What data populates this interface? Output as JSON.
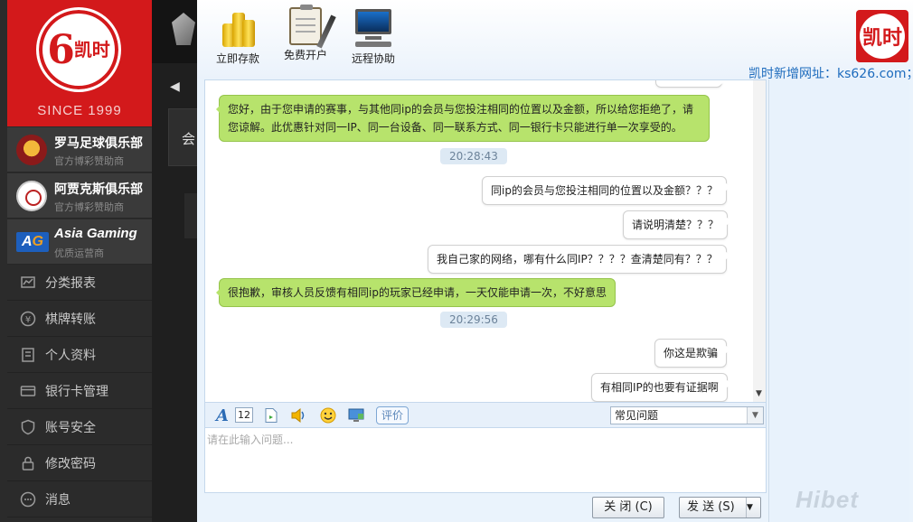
{
  "site": {
    "logo_text": "凯时",
    "since": "SINCE 1999",
    "sponsors": [
      {
        "name": "罗马足球俱乐部",
        "sub": "官方博彩赞助商"
      },
      {
        "name": "阿贾克斯俱乐部",
        "sub": "官方博彩赞助商"
      },
      {
        "name": "Asia Gaming",
        "sub": "优质运营商"
      }
    ],
    "menu": [
      {
        "label": "分类报表",
        "icon": "report-icon"
      },
      {
        "label": "棋牌转账",
        "icon": "yen-transfer-icon"
      },
      {
        "label": "个人资料",
        "icon": "profile-icon"
      },
      {
        "label": "银行卡管理",
        "icon": "bank-card-icon"
      },
      {
        "label": "账号安全",
        "icon": "shield-icon"
      },
      {
        "label": "修改密码",
        "icon": "lock-icon"
      },
      {
        "label": "消息",
        "icon": "message-icon"
      }
    ],
    "bg_panel_char": "会"
  },
  "chat": {
    "toolbar": [
      {
        "label": "立即存款",
        "icon": "coins-icon"
      },
      {
        "label": "免费开户",
        "icon": "notepad-icon"
      },
      {
        "label": "远程协助",
        "icon": "monitor-icon"
      }
    ],
    "brand_logo": "凯时",
    "site_url": "凯时新增网址：ks626.com；",
    "messages": [
      {
        "type": "agent",
        "text": "您好，由于您申请的赛事，与其他同ip的会员与您投注相同的位置以及金额，所以给您拒绝了，请您谅解。此优惠针对同一IP、同一台设备、同一联系方式、同一银行卡只能进行单一次享受的。"
      },
      {
        "type": "time",
        "text": "20:28:43"
      },
      {
        "type": "user",
        "text": "同ip的会员与您投注相同的位置以及金额？？？"
      },
      {
        "type": "user",
        "text": "请说明清楚？？？"
      },
      {
        "type": "user",
        "text": "我自己家的网络，哪有什么同IP？？？？查清楚同有？？？"
      },
      {
        "type": "agent",
        "text": "很抱歉，审核人员反馈有相同ip的玩家已经申请，一天仅能申请一次，不好意思"
      },
      {
        "type": "time",
        "text": "20:29:56"
      },
      {
        "type": "user",
        "text": "你这是欺骗"
      },
      {
        "type": "user",
        "text": "有相同IP的也要有证据啊"
      }
    ],
    "font_size": "12",
    "rate_label": "评价",
    "faq_selected": "常见问题",
    "input_placeholder": "请在此输入问题...",
    "close_label": "关 闭 (C)",
    "send_label": "发 送 (S)",
    "watermark": "Hibet"
  }
}
